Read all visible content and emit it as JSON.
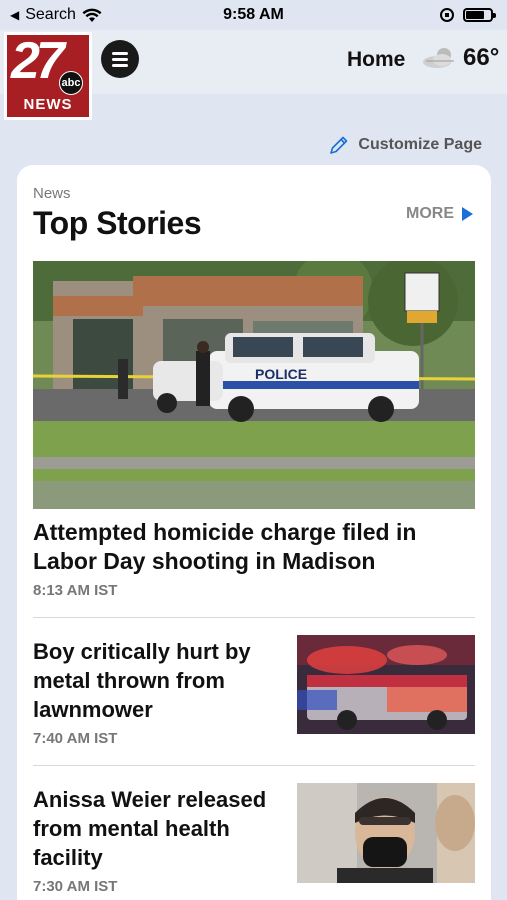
{
  "status_bar": {
    "back_label": "Search",
    "time": "9:58 AM"
  },
  "header": {
    "logo": {
      "number": "27",
      "network": "abc",
      "brand": "NEWS"
    },
    "home_label": "Home",
    "temperature": "66°",
    "weather_icon": "partly-cloudy-icon"
  },
  "customize": {
    "label": "Customize Page",
    "icon": "pencil-icon"
  },
  "section": {
    "eyebrow": "News",
    "title": "Top Stories",
    "more_label": "MORE"
  },
  "stories": [
    {
      "headline": "Attempted homicide charge filed in Labor Day shooting in Madison",
      "time": "8:13 AM IST"
    },
    {
      "headline": "Boy critically hurt by metal thrown from lawnmower",
      "time": "7:40 AM IST"
    },
    {
      "headline": "Anissa Weier released from mental health facility",
      "time": "7:30 AM IST"
    }
  ],
  "colors": {
    "background": "#dfe6f1",
    "brand_red": "#a81f23",
    "accent_blue": "#1a6fd8"
  }
}
